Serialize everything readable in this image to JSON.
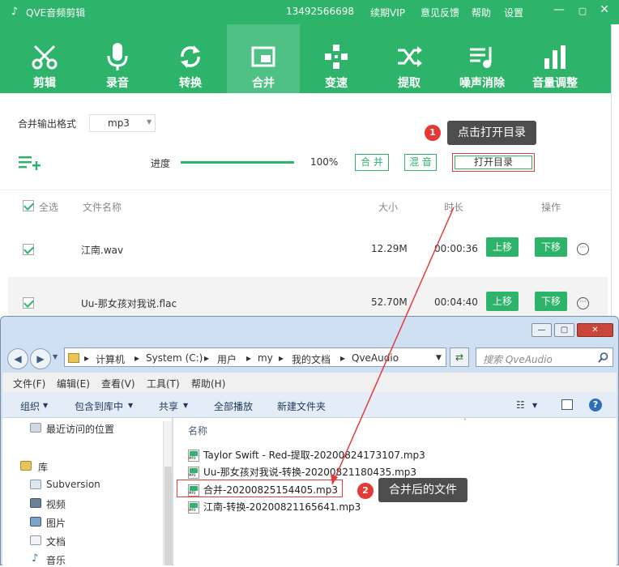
{
  "app": {
    "title": "QVE音频剪辑",
    "phone": "13492566698",
    "menu": [
      "续期VIP",
      "意见反馈",
      "帮助",
      "设置"
    ],
    "window_controls": [
      "minimize",
      "maximize",
      "close"
    ]
  },
  "toolbar": [
    {
      "label": "剪辑",
      "icon": "scissors-icon"
    },
    {
      "label": "录音",
      "icon": "microphone-icon"
    },
    {
      "label": "转换",
      "icon": "convert-icon"
    },
    {
      "label": "合并",
      "icon": "merge-icon",
      "active": true
    },
    {
      "label": "变速",
      "icon": "speed-icon"
    },
    {
      "label": "提取",
      "icon": "extract-icon"
    },
    {
      "label": "噪声消除",
      "icon": "denoise-icon"
    },
    {
      "label": "音量调整",
      "icon": "volume-icon"
    }
  ],
  "merge": {
    "format_label": "合并输出格式",
    "format_value": "mp3",
    "progress_label": "进度",
    "progress_value": "100%",
    "progress_fraction": 1.0,
    "merge_btn": "合 并",
    "mix_btn": "混 音",
    "open_dir_btn": "打开目录",
    "tip1_num": "1",
    "tip1_text": "点击打开目录"
  },
  "table": {
    "headers": {
      "select_all": "全选",
      "name": "文件名称",
      "size": "大小",
      "duration": "时长",
      "action": "操作"
    },
    "rows": [
      {
        "name": "江南.wav",
        "size": "12.29M",
        "duration": "00:00:36",
        "up": "上移",
        "down": "下移",
        "checked": true
      },
      {
        "name": "Uu-那女孩对我说.flac",
        "size": "52.70M",
        "duration": "00:04:40",
        "up": "上移",
        "down": "下移",
        "checked": true
      }
    ]
  },
  "explorer": {
    "controls": [
      "minimize",
      "maximize",
      "close"
    ],
    "path": [
      "计算机",
      "System (C:)",
      "用户",
      "my",
      "我的文档",
      "QveAudio"
    ],
    "search_placeholder": "搜索 QveAudio",
    "menus": [
      "文件(F)",
      "编辑(E)",
      "查看(V)",
      "工具(T)",
      "帮助(H)"
    ],
    "commands": [
      "组织",
      "包含到库中",
      "共享",
      "全部播放",
      "新建文件夹"
    ],
    "nav": [
      {
        "label": "最近访问的位置"
      },
      {
        "label": "库"
      },
      {
        "label": "Subversion"
      },
      {
        "label": "视频"
      },
      {
        "label": "图片"
      },
      {
        "label": "文档"
      },
      {
        "label": "音乐"
      }
    ],
    "column_name": "名称",
    "files": [
      "Taylor Swift - Red-提取-20200824173107.mp3",
      "Uu-那女孩对我说-转换-20200821180435.mp3",
      "合并-20200825154405.mp3",
      "江南-转换-20200821165641.mp3"
    ],
    "tip2_num": "2",
    "tip2_text": "合并后的文件"
  },
  "colors": {
    "brand": "#2db36a",
    "accent_red": "#e23b3b",
    "tooltip": "#4d4d4d"
  }
}
